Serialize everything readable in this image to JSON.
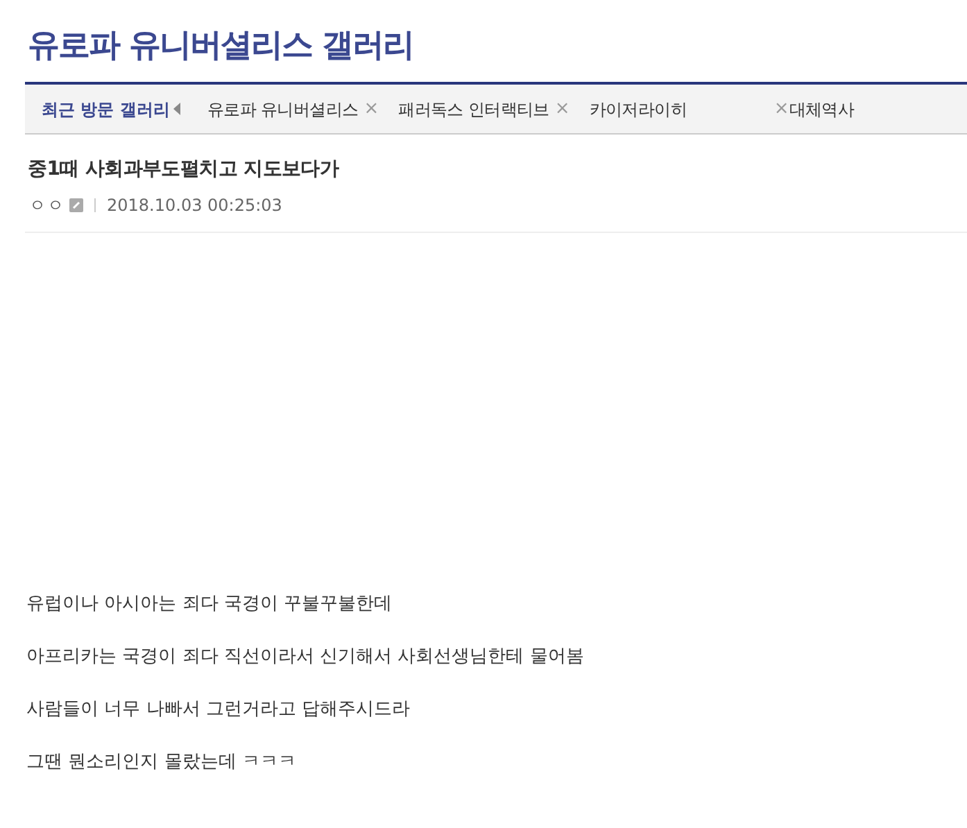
{
  "gallery_title": "유로파 유니버셜리스 갤러리",
  "recent_bar": {
    "label": "최근 방문 갤러리",
    "items": [
      {
        "name": "유로파 유니버셜리스",
        "close": "×"
      },
      {
        "name": "패러독스 인터랙티브",
        "close": "×"
      },
      {
        "name": "카이저라이히",
        "close": "×"
      },
      {
        "name": "대체역사"
      }
    ]
  },
  "post": {
    "title": "중1때 사회과부도펼치고 지도보다가",
    "author": "ㅇㅇ",
    "date": "2018.10.03 00:25:03",
    "body": [
      "유럽이나 아시아는 죄다 국경이 꾸불꾸불한데",
      "아프리카는 국경이 죄다 직선이라서 신기해서 사회선생님한테 물어봄",
      "사람들이 너무 나빠서 그런거라고 답해주시드라",
      "그땐 뭔소리인지 몰랐는데 ㅋㅋㅋ"
    ]
  }
}
